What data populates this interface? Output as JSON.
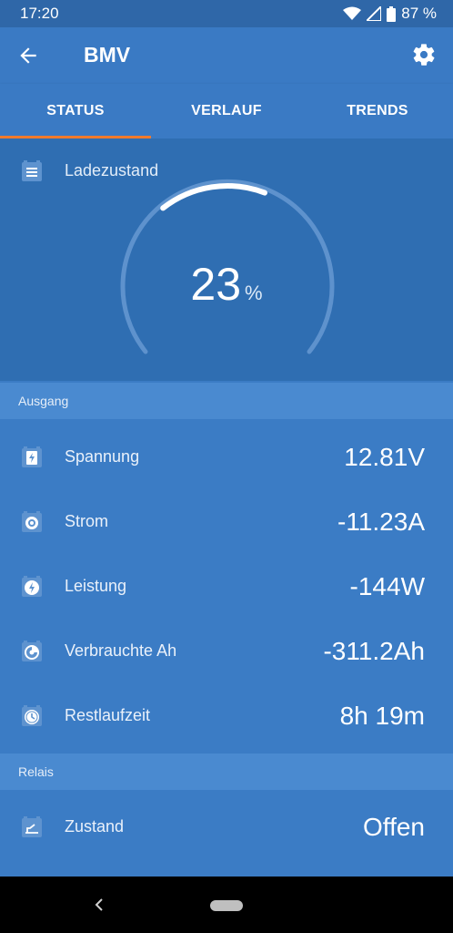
{
  "statusbar": {
    "time": "17:20",
    "battery": "87 %",
    "icons": [
      "wifi-icon",
      "signal-icon",
      "battery-icon"
    ]
  },
  "appbar": {
    "title": "BMV",
    "back_icon": "arrow-left-icon",
    "settings_icon": "gear-icon"
  },
  "tabs": [
    {
      "label": "STATUS",
      "active": true
    },
    {
      "label": "VERLAUF",
      "active": false
    },
    {
      "label": "TRENDS",
      "active": false
    }
  ],
  "gauge": {
    "label": "Ladezustand",
    "value": "23",
    "unit": "%",
    "percent": 23
  },
  "sections": {
    "output": {
      "header": "Ausgang",
      "rows": [
        {
          "label": "Spannung",
          "value": "12.81V",
          "icon": "voltage-icon"
        },
        {
          "label": "Strom",
          "value": "-11.23A",
          "icon": "current-icon"
        },
        {
          "label": "Leistung",
          "value": "-144W",
          "icon": "power-icon"
        },
        {
          "label": "Verbrauchte Ah",
          "value": "-311.2Ah",
          "icon": "consumed-ah-icon"
        },
        {
          "label": "Restlaufzeit",
          "value": "8h 19m",
          "icon": "clock-icon"
        }
      ]
    },
    "relay": {
      "header": "Relais",
      "rows": [
        {
          "label": "Zustand",
          "value": "Offen",
          "icon": "relay-icon"
        }
      ]
    }
  },
  "colors": {
    "primary": "#3a7ac4",
    "card": "#2f6eb2",
    "section_header": "#4a8ad0",
    "tab_indicator": "#f07a2c"
  }
}
